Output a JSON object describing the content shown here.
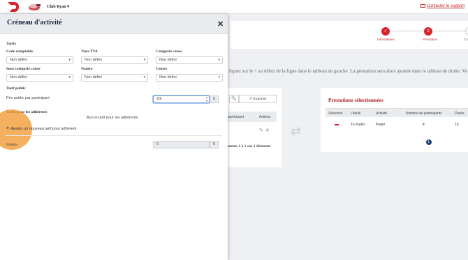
{
  "topbar": {
    "club_name": "Club Ryan",
    "support_link": "Contacter le support"
  },
  "steps": [
    {
      "number": "✓",
      "label": "Informations"
    },
    {
      "number": "2",
      "label": "Prestation"
    },
    {
      "number": "",
      "label": "Co"
    }
  ],
  "instruction": "liquez sur le + au début de la ligne dans le tableau de gauche. La prestation sera alors ajoutée dans le tableau de droite. Vo",
  "left_table": {
    "export_label": "Exporter",
    "headers": [
      "participant",
      "Actions"
    ],
    "footer": "ments 1 à 1 sur 1 éléments"
  },
  "right_table": {
    "title": "Prestations sélectionnées",
    "headers": [
      "Sélection",
      "Libellé",
      "Activité",
      "Nombre de participants",
      "Durée"
    ],
    "row": {
      "libelle": "1h Padel",
      "activite": "Padel",
      "participants": "4",
      "duree": "1h"
    },
    "page": "1"
  },
  "modal": {
    "title": "Créneau d'activité",
    "tarifs_heading": "Tarifs",
    "fields": {
      "code_comptable": {
        "label": "Code comptable",
        "value": "Non défini"
      },
      "taux_tva": {
        "label": "Taux TVA",
        "value": "Non défini"
      },
      "categorie_caisse": {
        "label": "Catégorie caisse",
        "value": "Non défini"
      },
      "sous_categorie_caisse": {
        "label": "Sous catégorie caisse",
        "value": "Non défini"
      },
      "nature": {
        "label": "Nature",
        "value": "Non défini"
      },
      "centre": {
        "label": "Centre",
        "value": "Non défini"
      }
    },
    "tarif_public_heading": "Tarif public",
    "prix_public_label": "Prix public par participant",
    "prix_public_value": "20",
    "currency": "€",
    "adherents_heading": "Tarifs pour les adhérents",
    "no_adherent_text": "Aucun tarif pour les adhérents.",
    "add_tarif_label": "Ajouter un nouveau tarif pour adhérent",
    "invites_label": "Invités",
    "invites_value": "0"
  }
}
